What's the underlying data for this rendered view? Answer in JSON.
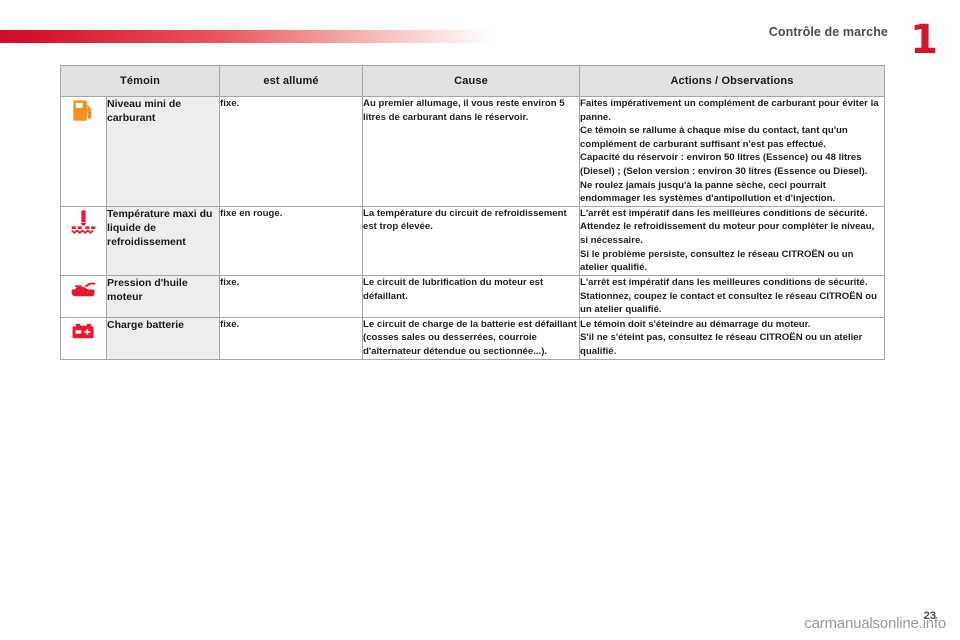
{
  "page": {
    "section_title": "Contrôle de marche",
    "chapter_number": "1",
    "page_number": "23",
    "watermark": "carmanualsonline.info",
    "accent_color": "#d7142d",
    "header_bg": "#e2e2e2",
    "name_cell_bg": "#ededed"
  },
  "table": {
    "headers": {
      "icon": "Témoin",
      "state": "est allumé",
      "cause": "Cause",
      "actions": "Actions / Observations"
    },
    "rows": [
      {
        "icon_name": "fuel-pump-icon",
        "icon_color": "#f5901f",
        "name": "Niveau mini de carburant",
        "state": "fixe.",
        "cause": "Au premier allumage, il vous reste environ 5 litres de carburant dans le réservoir.",
        "actions": [
          "Faites impérativement un complément de carburant pour éviter la panne.",
          "Ce témoin se rallume à chaque mise du contact, tant qu'un complément de carburant suffisant n'est pas effectué.",
          "Capacité du réservoir : environ 50 litres (Essence) ou 48 litres (Diesel) ; (Selon version : environ 30 litres (Essence ou Diesel).",
          "Ne roulez jamais jusqu'à la panne sèche, ceci pourrait endommager les systèmes d'antipollution et d'injection."
        ]
      },
      {
        "icon_name": "coolant-temperature-icon",
        "icon_color": "#e8192c",
        "name": "Température maxi du liquide de refroidissement",
        "state": "fixe en rouge.",
        "cause": "La température du circuit de refroidissement est trop élevée.",
        "actions": [
          "L'arrêt est impératif dans les meilleures conditions de sécurité.",
          "Attendez le refroidissement du moteur pour compléter le niveau, si nécessaire.",
          "Si le problème persiste, consultez le réseau CITROËN ou un atelier qualifié."
        ]
      },
      {
        "icon_name": "oil-pressure-icon",
        "icon_color": "#e8192c",
        "name": "Pression d'huile moteur",
        "state": "fixe.",
        "cause": "Le circuit de lubrification du moteur est défaillant.",
        "actions": [
          "L'arrêt est impératif dans les meilleures conditions de sécurité.",
          "Stationnez, coupez le contact et consultez le réseau CITROËN ou un atelier qualifié."
        ]
      },
      {
        "icon_name": "battery-charge-icon",
        "icon_color": "#e8192c",
        "name": "Charge batterie",
        "state": "fixe.",
        "cause": "Le circuit de charge de la batterie est défaillant (cosses sales ou desserrées, courroie d'alternateur détendue ou sectionnée...).",
        "actions": [
          "Le témoin doit s'éteindre au démarrage du moteur.",
          "S'il ne s'éteint pas, consultez le réseau CITROËN ou un atelier qualifié."
        ]
      }
    ]
  }
}
